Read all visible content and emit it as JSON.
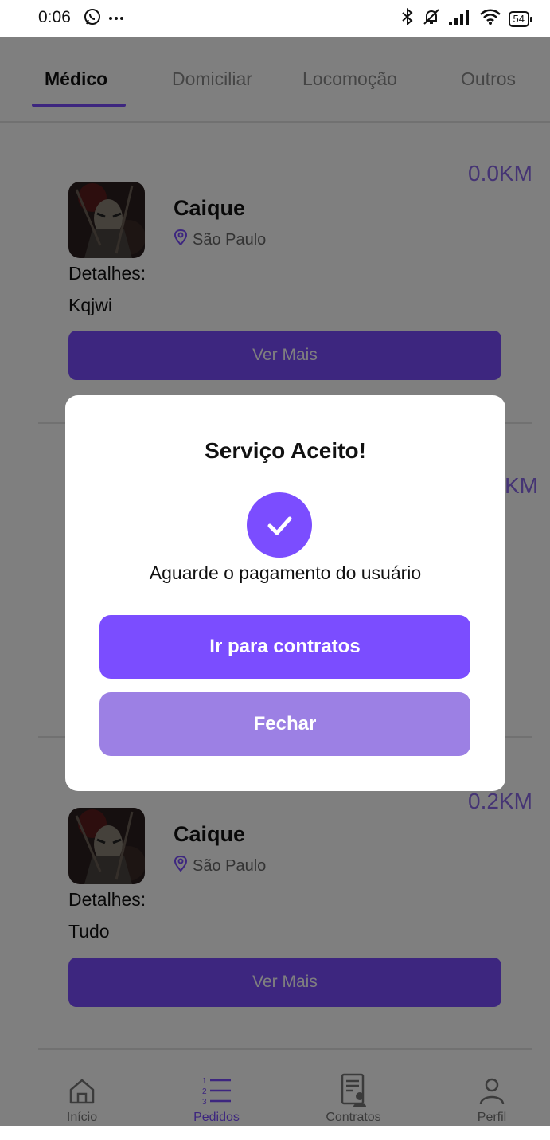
{
  "status_bar": {
    "time": "0:06",
    "left_icons": [
      "whatsapp-icon",
      "more-dots-icon"
    ],
    "right_icons": [
      "bluetooth-icon",
      "bell-off-icon",
      "signal-icon",
      "wifi-icon"
    ],
    "battery": "54"
  },
  "tabs": [
    {
      "label": "Médico",
      "active": true
    },
    {
      "label": "Domiciliar",
      "active": false
    },
    {
      "label": "Locomoção",
      "active": false
    },
    {
      "label": "Outros",
      "active": false
    }
  ],
  "cards": [
    {
      "name": "Caique",
      "location": "São Paulo",
      "distance": "0.0KM",
      "details_label": "Detalhes:",
      "details": "Kqjwi",
      "button": "Ver Mais"
    },
    {
      "distance": "KM"
    },
    {
      "name": "Caique",
      "location": "São Paulo",
      "distance": "0.2KM",
      "details_label": "Detalhes:",
      "details": "Tudo",
      "button": "Ver Mais"
    }
  ],
  "dialog": {
    "title": "Serviço Aceito!",
    "message": "Aguarde o pagamento do usuário",
    "primary_button": "Ir para contratos",
    "secondary_button": "Fechar"
  },
  "bottom_nav": [
    {
      "label": "Início",
      "icon": "home-icon",
      "active": false
    },
    {
      "label": "Pedidos",
      "icon": "list-icon",
      "active": true
    },
    {
      "label": "Contratos",
      "icon": "contract-icon",
      "active": false
    },
    {
      "label": "Perfil",
      "icon": "user-icon",
      "active": false
    }
  ],
  "colors": {
    "accent": "#7b4dff",
    "accent_light": "#9c80e4",
    "distance_text": "#8a68e8",
    "overlay": "rgba(0,0,0,0.5)"
  }
}
